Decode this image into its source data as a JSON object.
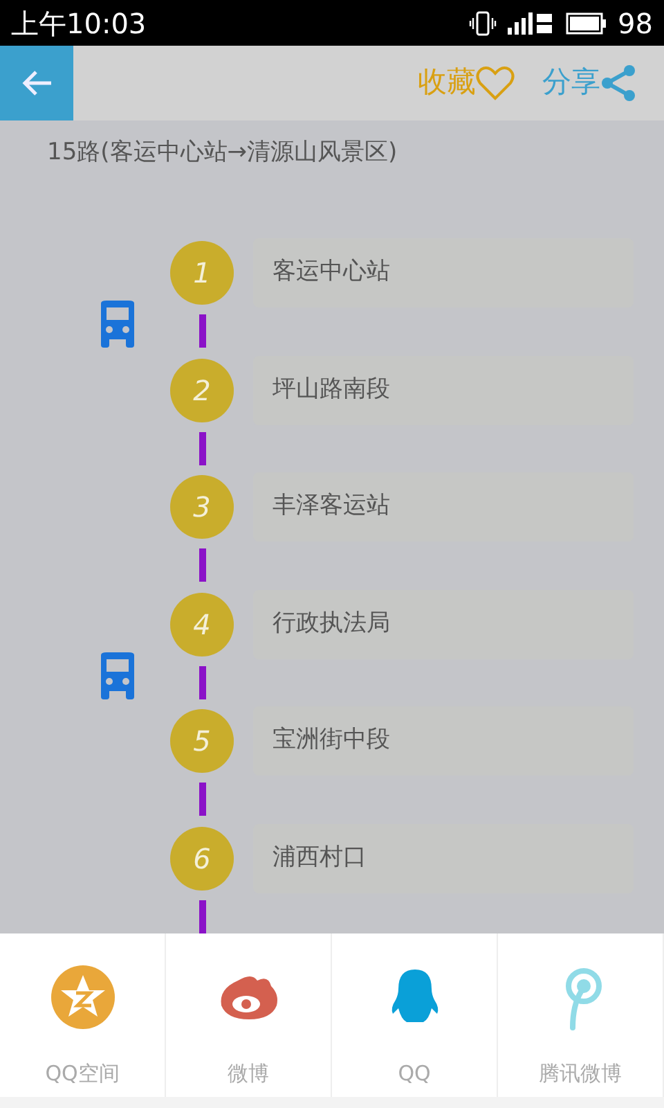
{
  "status_bar": {
    "time": "上午10:03",
    "battery": "98"
  },
  "header": {
    "favorite": "收藏",
    "share": "分享"
  },
  "route_title": "15路(客运中心站→清源山风景区)",
  "stops": [
    {
      "number": "1",
      "name": "客运中心站",
      "bus_after": true
    },
    {
      "number": "2",
      "name": "坪山路南段",
      "bus_after": false
    },
    {
      "number": "3",
      "name": "丰泽客运站",
      "bus_after": false
    },
    {
      "number": "4",
      "name": "行政执法局",
      "bus_after": true
    },
    {
      "number": "5",
      "name": "宝洲街中段",
      "bus_after": false
    },
    {
      "number": "6",
      "name": "浦西村口",
      "bus_after": false
    }
  ],
  "share_sheet": [
    {
      "kind": "qzone",
      "label": "QQ空间"
    },
    {
      "kind": "weibo",
      "label": "微博"
    },
    {
      "kind": "qq",
      "label": "QQ"
    },
    {
      "kind": "tweibo",
      "label": "腾讯微博"
    }
  ]
}
